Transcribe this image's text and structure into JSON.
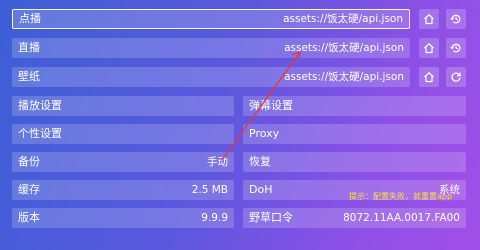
{
  "config_rows": [
    {
      "label": "点播",
      "value": "assets://饭太硬/api.json"
    },
    {
      "label": "直播",
      "value": "assets://饭太硬/api.json"
    },
    {
      "label": "壁纸",
      "value": "assets://饭太硬/api.json"
    }
  ],
  "settings_left": [
    {
      "label": "播放设置",
      "value": ""
    },
    {
      "label": "个性设置",
      "value": ""
    },
    {
      "label": "备份",
      "value": "手动"
    },
    {
      "label": "缓存",
      "value": "2.5 MB"
    },
    {
      "label": "版本",
      "value": "9.9.9"
    }
  ],
  "settings_right": [
    {
      "label": "弹幕设置",
      "value": ""
    },
    {
      "label": "Proxy",
      "value": ""
    },
    {
      "label": "恢复",
      "value": ""
    },
    {
      "label": "DoH",
      "value": "系统"
    },
    {
      "label": "野草口令",
      "value": "8072.11AA.0017.FA00"
    }
  ],
  "hint": {
    "text": "提示：配置失败，就重置app"
  },
  "icons": {
    "home": "home-icon",
    "history": "history-icon",
    "refresh": "refresh-icon"
  },
  "colors": {
    "hint": "#ffe14a",
    "arrow": "#e23b3b"
  }
}
